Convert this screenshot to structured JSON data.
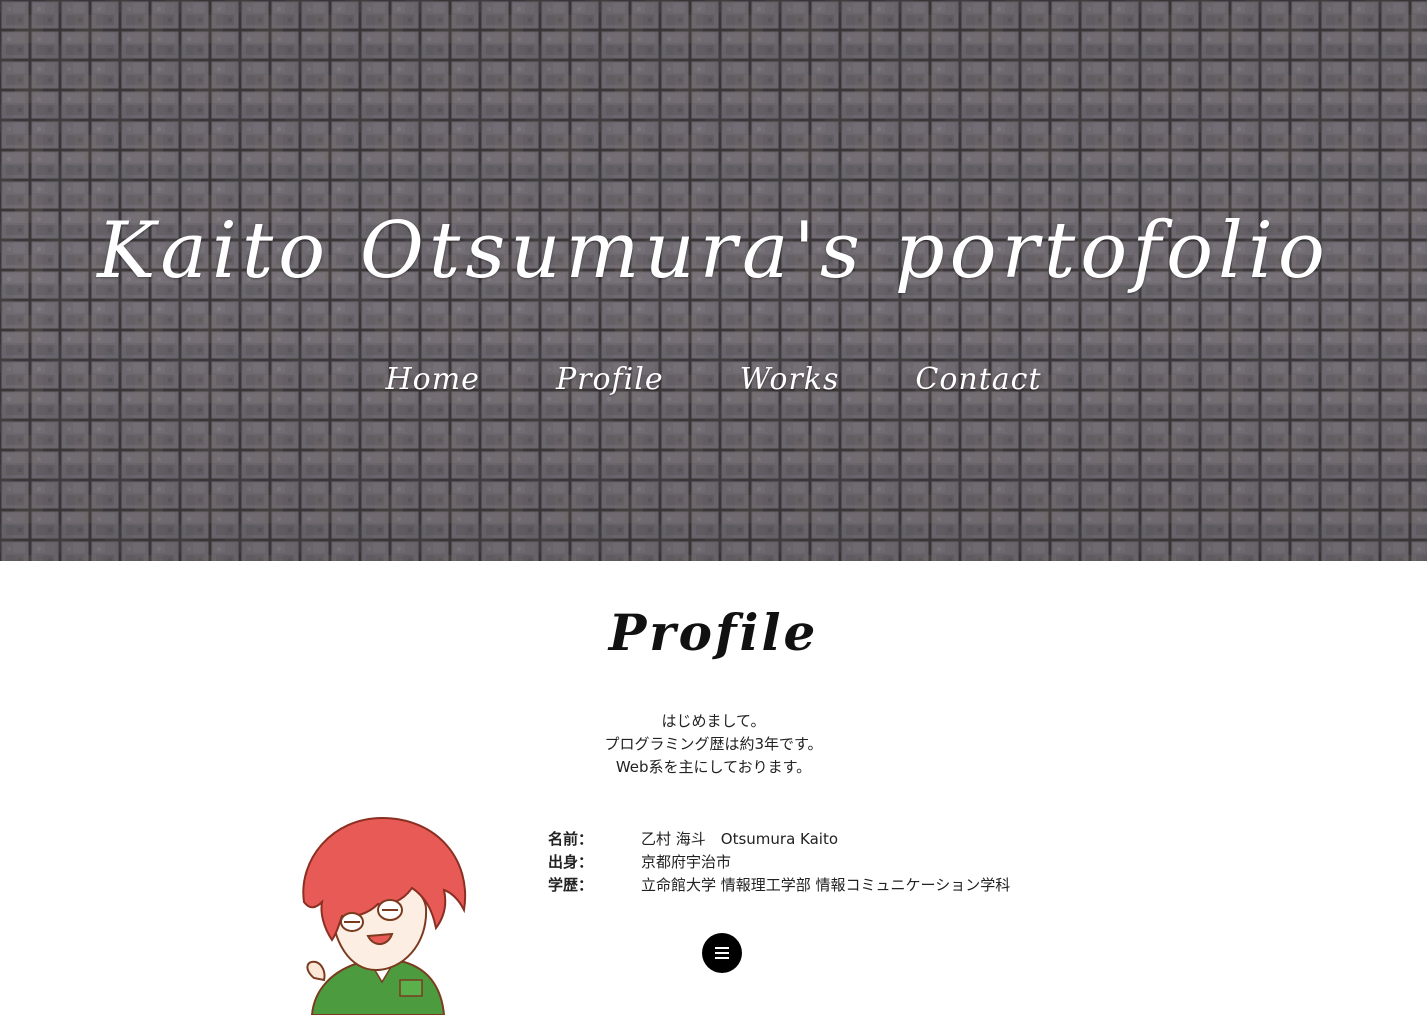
{
  "hero": {
    "title": "Kaito Otsumura's portofolio",
    "background": "stone-tile-wall",
    "colors": {
      "tile": "#6f6a6c",
      "grout": "#3d393b",
      "text": "#ffffff"
    }
  },
  "nav": {
    "items": [
      {
        "label": "Home"
      },
      {
        "label": "Profile"
      },
      {
        "label": "Works"
      },
      {
        "label": "Contact"
      }
    ]
  },
  "profile": {
    "heading": "Profile",
    "intro": [
      "はじめまして。",
      "プログラミング歴は約3年です。",
      "Web系を主にしております。"
    ],
    "avatar": "red-haired-character-illustration",
    "info": [
      {
        "label": "名前：",
        "value": "乙村 海斗　Otsumura Kaito"
      },
      {
        "label": "出身：",
        "value": "京都府宇治市"
      },
      {
        "label": "学歴：",
        "value": "立命館大学 情報理工学部 情報コミュニケーション学科"
      }
    ]
  },
  "menu_button": {
    "icon": "hamburger-menu-icon",
    "color": "#000000"
  }
}
